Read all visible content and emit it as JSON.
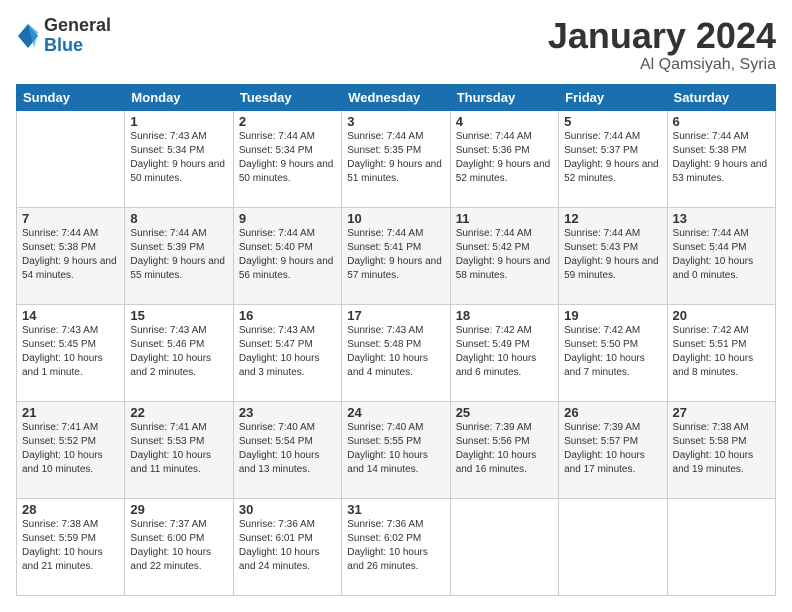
{
  "logo": {
    "general": "General",
    "blue": "Blue"
  },
  "title": {
    "month": "January 2024",
    "location": "Al Qamsiyah, Syria"
  },
  "days_header": [
    "Sunday",
    "Monday",
    "Tuesday",
    "Wednesday",
    "Thursday",
    "Friday",
    "Saturday"
  ],
  "weeks": [
    [
      {
        "num": "",
        "sunrise": "",
        "sunset": "",
        "daylight": ""
      },
      {
        "num": "1",
        "sunrise": "Sunrise: 7:43 AM",
        "sunset": "Sunset: 5:34 PM",
        "daylight": "Daylight: 9 hours and 50 minutes."
      },
      {
        "num": "2",
        "sunrise": "Sunrise: 7:44 AM",
        "sunset": "Sunset: 5:34 PM",
        "daylight": "Daylight: 9 hours and 50 minutes."
      },
      {
        "num": "3",
        "sunrise": "Sunrise: 7:44 AM",
        "sunset": "Sunset: 5:35 PM",
        "daylight": "Daylight: 9 hours and 51 minutes."
      },
      {
        "num": "4",
        "sunrise": "Sunrise: 7:44 AM",
        "sunset": "Sunset: 5:36 PM",
        "daylight": "Daylight: 9 hours and 52 minutes."
      },
      {
        "num": "5",
        "sunrise": "Sunrise: 7:44 AM",
        "sunset": "Sunset: 5:37 PM",
        "daylight": "Daylight: 9 hours and 52 minutes."
      },
      {
        "num": "6",
        "sunrise": "Sunrise: 7:44 AM",
        "sunset": "Sunset: 5:38 PM",
        "daylight": "Daylight: 9 hours and 53 minutes."
      }
    ],
    [
      {
        "num": "7",
        "sunrise": "Sunrise: 7:44 AM",
        "sunset": "Sunset: 5:38 PM",
        "daylight": "Daylight: 9 hours and 54 minutes."
      },
      {
        "num": "8",
        "sunrise": "Sunrise: 7:44 AM",
        "sunset": "Sunset: 5:39 PM",
        "daylight": "Daylight: 9 hours and 55 minutes."
      },
      {
        "num": "9",
        "sunrise": "Sunrise: 7:44 AM",
        "sunset": "Sunset: 5:40 PM",
        "daylight": "Daylight: 9 hours and 56 minutes."
      },
      {
        "num": "10",
        "sunrise": "Sunrise: 7:44 AM",
        "sunset": "Sunset: 5:41 PM",
        "daylight": "Daylight: 9 hours and 57 minutes."
      },
      {
        "num": "11",
        "sunrise": "Sunrise: 7:44 AM",
        "sunset": "Sunset: 5:42 PM",
        "daylight": "Daylight: 9 hours and 58 minutes."
      },
      {
        "num": "12",
        "sunrise": "Sunrise: 7:44 AM",
        "sunset": "Sunset: 5:43 PM",
        "daylight": "Daylight: 9 hours and 59 minutes."
      },
      {
        "num": "13",
        "sunrise": "Sunrise: 7:44 AM",
        "sunset": "Sunset: 5:44 PM",
        "daylight": "Daylight: 10 hours and 0 minutes."
      }
    ],
    [
      {
        "num": "14",
        "sunrise": "Sunrise: 7:43 AM",
        "sunset": "Sunset: 5:45 PM",
        "daylight": "Daylight: 10 hours and 1 minute."
      },
      {
        "num": "15",
        "sunrise": "Sunrise: 7:43 AM",
        "sunset": "Sunset: 5:46 PM",
        "daylight": "Daylight: 10 hours and 2 minutes."
      },
      {
        "num": "16",
        "sunrise": "Sunrise: 7:43 AM",
        "sunset": "Sunset: 5:47 PM",
        "daylight": "Daylight: 10 hours and 3 minutes."
      },
      {
        "num": "17",
        "sunrise": "Sunrise: 7:43 AM",
        "sunset": "Sunset: 5:48 PM",
        "daylight": "Daylight: 10 hours and 4 minutes."
      },
      {
        "num": "18",
        "sunrise": "Sunrise: 7:42 AM",
        "sunset": "Sunset: 5:49 PM",
        "daylight": "Daylight: 10 hours and 6 minutes."
      },
      {
        "num": "19",
        "sunrise": "Sunrise: 7:42 AM",
        "sunset": "Sunset: 5:50 PM",
        "daylight": "Daylight: 10 hours and 7 minutes."
      },
      {
        "num": "20",
        "sunrise": "Sunrise: 7:42 AM",
        "sunset": "Sunset: 5:51 PM",
        "daylight": "Daylight: 10 hours and 8 minutes."
      }
    ],
    [
      {
        "num": "21",
        "sunrise": "Sunrise: 7:41 AM",
        "sunset": "Sunset: 5:52 PM",
        "daylight": "Daylight: 10 hours and 10 minutes."
      },
      {
        "num": "22",
        "sunrise": "Sunrise: 7:41 AM",
        "sunset": "Sunset: 5:53 PM",
        "daylight": "Daylight: 10 hours and 11 minutes."
      },
      {
        "num": "23",
        "sunrise": "Sunrise: 7:40 AM",
        "sunset": "Sunset: 5:54 PM",
        "daylight": "Daylight: 10 hours and 13 minutes."
      },
      {
        "num": "24",
        "sunrise": "Sunrise: 7:40 AM",
        "sunset": "Sunset: 5:55 PM",
        "daylight": "Daylight: 10 hours and 14 minutes."
      },
      {
        "num": "25",
        "sunrise": "Sunrise: 7:39 AM",
        "sunset": "Sunset: 5:56 PM",
        "daylight": "Daylight: 10 hours and 16 minutes."
      },
      {
        "num": "26",
        "sunrise": "Sunrise: 7:39 AM",
        "sunset": "Sunset: 5:57 PM",
        "daylight": "Daylight: 10 hours and 17 minutes."
      },
      {
        "num": "27",
        "sunrise": "Sunrise: 7:38 AM",
        "sunset": "Sunset: 5:58 PM",
        "daylight": "Daylight: 10 hours and 19 minutes."
      }
    ],
    [
      {
        "num": "28",
        "sunrise": "Sunrise: 7:38 AM",
        "sunset": "Sunset: 5:59 PM",
        "daylight": "Daylight: 10 hours and 21 minutes."
      },
      {
        "num": "29",
        "sunrise": "Sunrise: 7:37 AM",
        "sunset": "Sunset: 6:00 PM",
        "daylight": "Daylight: 10 hours and 22 minutes."
      },
      {
        "num": "30",
        "sunrise": "Sunrise: 7:36 AM",
        "sunset": "Sunset: 6:01 PM",
        "daylight": "Daylight: 10 hours and 24 minutes."
      },
      {
        "num": "31",
        "sunrise": "Sunrise: 7:36 AM",
        "sunset": "Sunset: 6:02 PM",
        "daylight": "Daylight: 10 hours and 26 minutes."
      },
      {
        "num": "",
        "sunrise": "",
        "sunset": "",
        "daylight": ""
      },
      {
        "num": "",
        "sunrise": "",
        "sunset": "",
        "daylight": ""
      },
      {
        "num": "",
        "sunrise": "",
        "sunset": "",
        "daylight": ""
      }
    ]
  ]
}
